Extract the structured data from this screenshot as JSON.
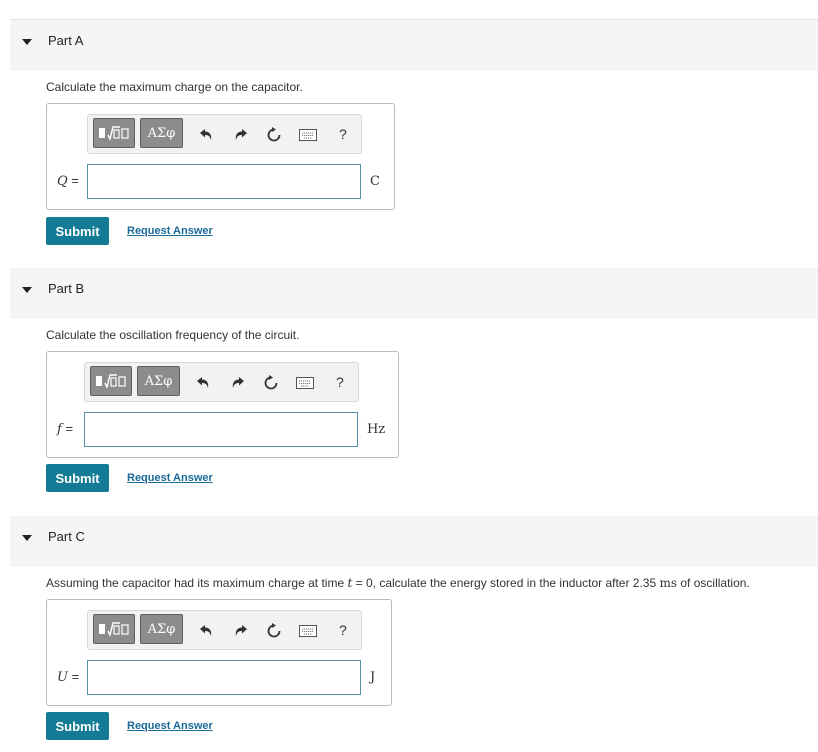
{
  "colors": {
    "submit_bg": "#137b95",
    "link": "#1a6a9a",
    "header_bg": "#f5f5f5",
    "input_border": "#5a8fa8"
  },
  "toolbar": {
    "greek_label": "ΑΣφ",
    "help_label": "?",
    "icons": [
      "templates-icon",
      "greek-letters-icon",
      "undo-icon",
      "redo-icon",
      "reset-icon",
      "keyboard-icon",
      "help-icon"
    ]
  },
  "parts": [
    {
      "title": "Part A",
      "question": "Calculate the maximum charge on the capacitor.",
      "variable": "Q",
      "equals": "=",
      "unit": "C",
      "input_value": "",
      "submit_label": "Submit",
      "request_label": "Request Answer"
    },
    {
      "title": "Part B",
      "question": "Calculate the oscillation frequency of the circuit.",
      "variable": "f",
      "equals": "=",
      "unit": "Hz",
      "input_value": "",
      "submit_label": "Submit",
      "request_label": "Request Answer"
    },
    {
      "title": "Part C",
      "question_pre": "Assuming the capacitor had its maximum charge at time ",
      "question_var": "t",
      "question_mid": " = 0, calculate the energy stored in the inductor after 2.35 ",
      "question_unit": "ms",
      "question_post": " of oscillation.",
      "variable": "U",
      "equals": "=",
      "unit": "J",
      "input_value": "",
      "submit_label": "Submit",
      "request_label": "Request Answer"
    }
  ]
}
